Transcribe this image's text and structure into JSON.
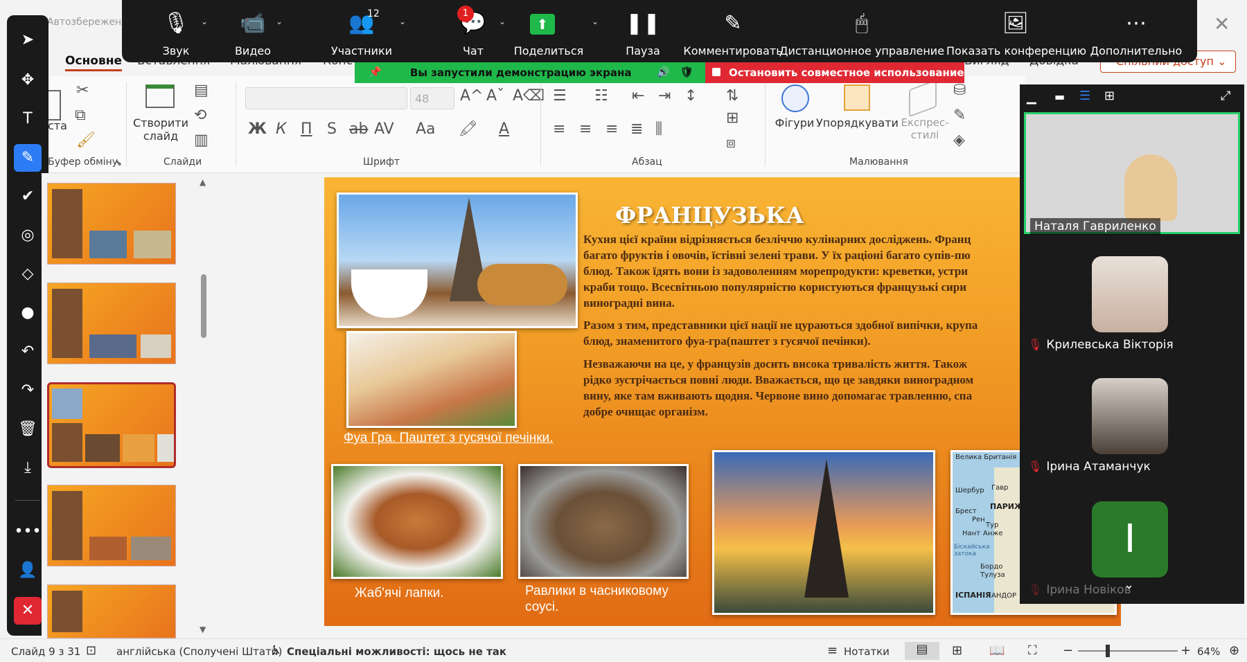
{
  "window": {
    "autosave_label": "Автозбереження",
    "close_glyph": "✕"
  },
  "ribbon": {
    "tabs": [
      "Основне",
      "Вставлення",
      "Малювання",
      "Конс",
      "Вигляд",
      "Довідка"
    ],
    "share_button": "Спільний доступ",
    "groups": {
      "clipboard": "Буфер обміну",
      "slides": "Слайди",
      "font": "Шрифт",
      "paragraph": "Абзац",
      "drawing": "Малювання"
    },
    "paste_label": "Вставити",
    "new_slide_label": "Створити слайд",
    "font_size": "48",
    "shapes_label": "Фігури",
    "arrange_label": "Упорядкувати",
    "express_styles_label": "Експрес-стилі",
    "font_buttons": [
      "Ж",
      "К",
      "П",
      "S",
      "ab",
      "AV",
      "Aa"
    ]
  },
  "meeting_toolbar": {
    "buttons": [
      {
        "label": "Звук",
        "icon": "microphone-icon"
      },
      {
        "label": "Видео",
        "icon": "video-camera-icon"
      },
      {
        "label": "Участники",
        "icon": "participants-icon"
      },
      {
        "label": "Чат",
        "icon": "chat-icon"
      },
      {
        "label": "Поделиться",
        "icon": "share-screen-icon"
      },
      {
        "label": "Пауза",
        "icon": "pause-icon"
      },
      {
        "label": "Комментировать",
        "icon": "annotate-pen-icon"
      },
      {
        "label": "Дистанционное управление",
        "icon": "mouse-icon"
      },
      {
        "label": "Показать конференцию",
        "icon": "show-meeting-icon"
      },
      {
        "label": "Дополнительно",
        "icon": "more-icon"
      }
    ],
    "participants_count": "12",
    "chat_badge": "1",
    "share_banner": "Вы запустили демонстрацию экрана",
    "stop_share": "Остановить совместное использование",
    "colors": {
      "toolbar_bg": "#1a1a1a",
      "share_green": "#1fb84a",
      "stop_red": "#e02833"
    }
  },
  "slide": {
    "title": "ФРАНЦУЗЬКА",
    "paragraphs": [
      "Кухня цієї країни відрізняється безліччю кулінарних досліджень. Франц\nбагато фруктів і овочів, їстівні зелені трави. У їх раціоні багато супів-пю\nблюд. Також їдять вони із задоволенням морепродукти: креветки, устри\nкраби тощо. Всесвітньою популярністю користуються французькі сири\nвиноградні вина.",
      "Разом з тим, представники цієї нації не цураються здобної випічки, крупа\nблюд, знаменитого фуа-гра(паштет з гусячої печінки).",
      "Незважаючи на це, у французів досить висока тривалість життя. Також\nрідко зустрічається повні люди. Вважається, що це завдяки виноградном\nвину, яке там вживають щодня. Червоне вино допомагає травленню, спа\nдобре очищає організм."
    ],
    "captions": {
      "foie_gras": "Фуа Гра. Паштет з гусячої печінки.",
      "frog_legs": "Жаб'ячі лапки.",
      "snails": "Равлики в часниковому соусі."
    },
    "map_labels": [
      "Велика Британія",
      "Гавр",
      "Шербур",
      "ПАРИЖ",
      "Брест",
      "Рен",
      "Нант",
      "Тур",
      "Анже",
      "Біскайська затока",
      "Бордо",
      "Тулуза",
      "ІСПАНІЯ",
      "АНДОР"
    ]
  },
  "participants": {
    "main": "Наталя Гавриленко",
    "list": [
      "Крилевська Вікторія",
      "Ірина Атаманчук",
      "Ірина Новіков"
    ],
    "avatar_initial": "І"
  },
  "statusbar": {
    "slide_info": "Слайд 9 з 31",
    "language": "англійська (Сполучені Штати)",
    "accessibility": "Спеціальні можливості: щось не так",
    "notes": "Нотатки",
    "zoom": "64%"
  }
}
